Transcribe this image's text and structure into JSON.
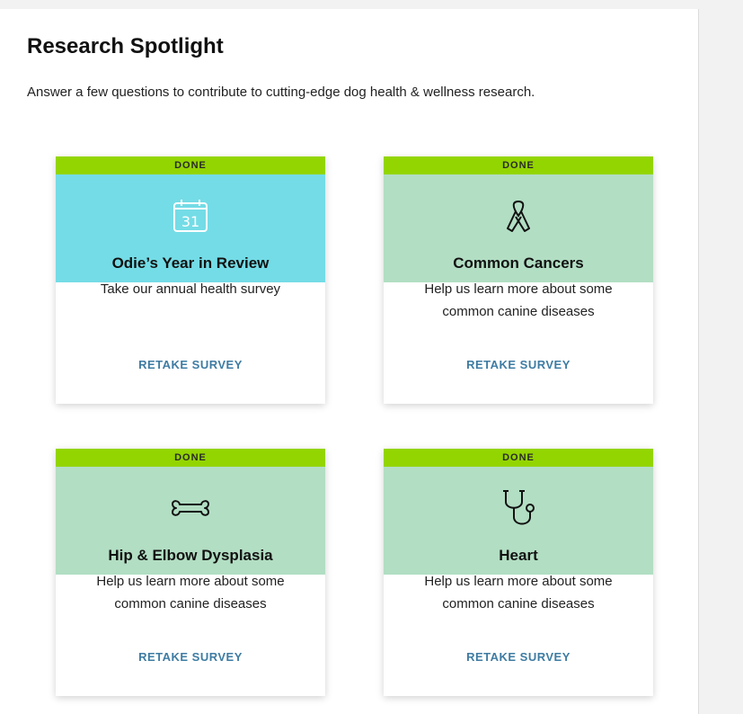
{
  "page": {
    "title": "Research Spotlight",
    "subtitle": "Answer a few questions to contribute to cutting-edge dog health & wellness research."
  },
  "colors": {
    "status_bar": "#93d500",
    "year_review_bg": "#74dce6",
    "disease_bg": "#b2dec3",
    "link": "#3e7ca3"
  },
  "cards": [
    {
      "status": "DONE",
      "icon": "calendar-icon",
      "icon_text": "31",
      "title": "Odie’s Year in Review",
      "description": "Take our annual health survey",
      "action": "RETAKE SURVEY"
    },
    {
      "status": "DONE",
      "icon": "cancer-ribbon-icon",
      "title": "Common Cancers",
      "description": "Help us learn more about some common canine diseases",
      "action": "RETAKE SURVEY"
    },
    {
      "status": "DONE",
      "icon": "bone-icon",
      "title": "Hip & Elbow Dysplasia",
      "description": "Help us learn more about some common canine diseases",
      "action": "RETAKE SURVEY"
    },
    {
      "status": "DONE",
      "icon": "stethoscope-icon",
      "title": "Heart",
      "description": "Help us learn more about some common canine diseases",
      "action": "RETAKE SURVEY"
    }
  ]
}
